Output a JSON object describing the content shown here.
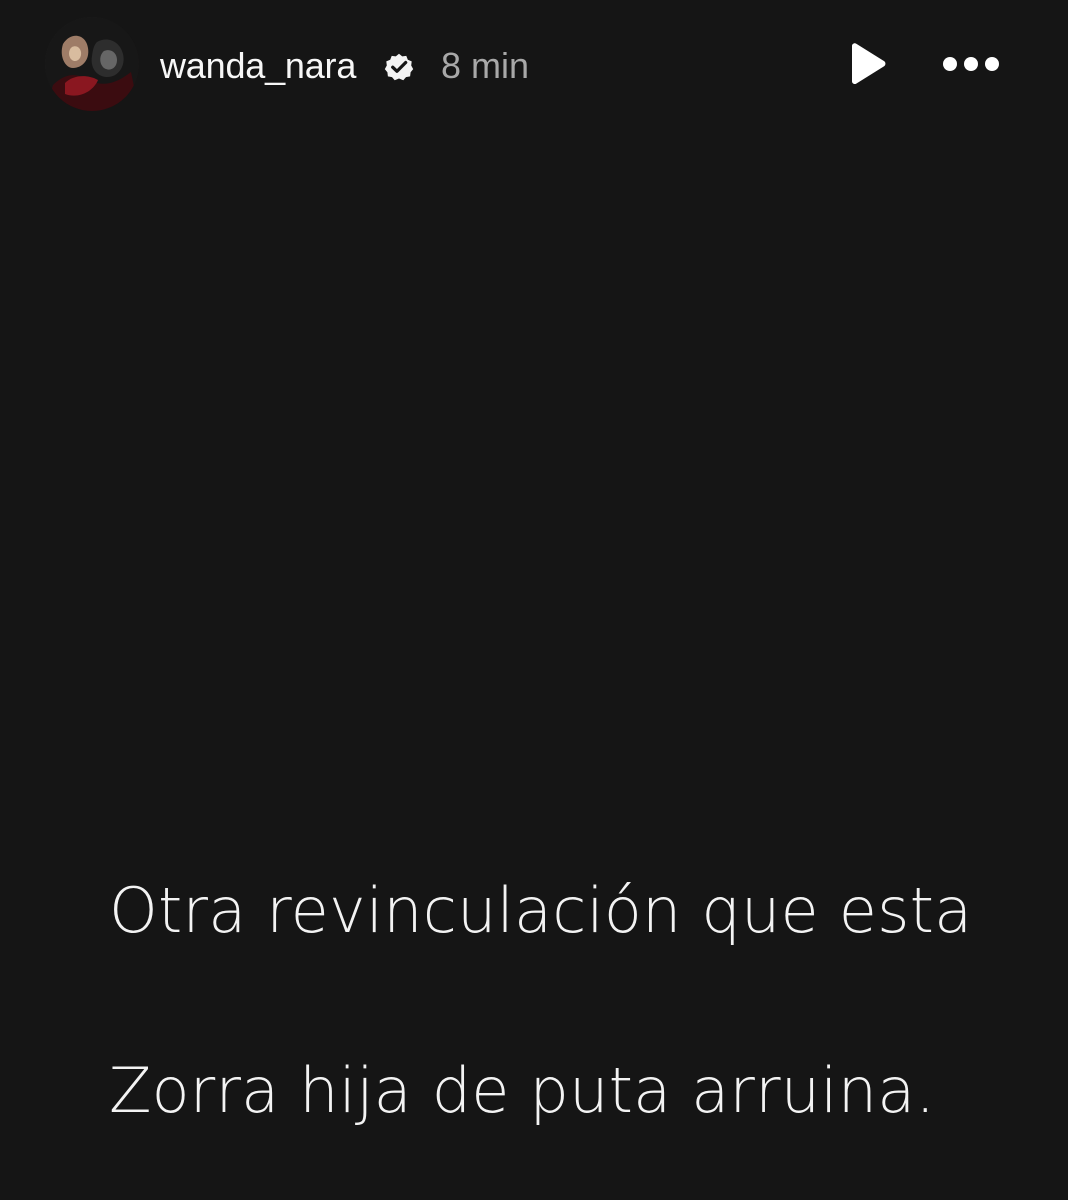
{
  "story": {
    "background_color": "#151515",
    "header": {
      "username": "wanda_nara",
      "verified_icon": "verified-badge-icon",
      "time_ago": "8 min",
      "play_icon": "play-icon",
      "more_icon": "more-options-icon"
    },
    "text": {
      "line_1": "Otra  revinculación que esta",
      "line_2": "Zorra hija de puta arruina."
    }
  },
  "colors": {
    "primary_text": "#f3f3f3",
    "secondary_text": "#a8a8a8",
    "icon": "#ffffff"
  }
}
